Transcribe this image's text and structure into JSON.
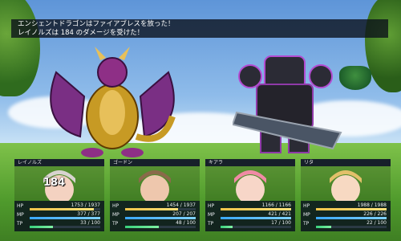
{
  "message": {
    "line1": "エンシェントドラゴンはファイアブレスを放った！",
    "line2": "レイノルズは 184 のダメージを受けた！"
  },
  "enemies": [
    {
      "name": "ancient-dragon"
    },
    {
      "name": "dark-robot"
    }
  ],
  "party": [
    {
      "name": "レイノルズ",
      "hp": "1753 / 1937",
      "mp": "377 / 377",
      "tp": "33 / 100",
      "hp_frac": 0.905,
      "mp_frac": 1.0,
      "tp_frac": 0.33,
      "damage": "184",
      "hair": "#d8d3cf",
      "skin": "#f4d2c1"
    },
    {
      "name": "ゴードン",
      "hp": "1454 / 1937",
      "mp": "207 / 207",
      "tp": "48 / 100",
      "hp_frac": 0.751,
      "mp_frac": 1.0,
      "tp_frac": 0.48,
      "damage": "",
      "hair": "#8a6a4a",
      "skin": "#eec7ad"
    },
    {
      "name": "キアラ",
      "hp": "1166 / 1166",
      "mp": "421 / 421",
      "tp": "17 / 100",
      "hp_frac": 1.0,
      "mp_frac": 1.0,
      "tp_frac": 0.17,
      "damage": "",
      "hair": "#f08aa5",
      "skin": "#f7d6c8"
    },
    {
      "name": "リタ",
      "hp": "1988 / 1988",
      "mp": "226 / 226",
      "tp": "22 / 100",
      "hp_frac": 1.0,
      "mp_frac": 1.0,
      "tp_frac": 0.22,
      "damage": "",
      "hair": "#e2c06a",
      "skin": "#f7d9c2"
    }
  ],
  "labels": {
    "hp": "HP",
    "mp": "MP",
    "tp": "TP"
  }
}
